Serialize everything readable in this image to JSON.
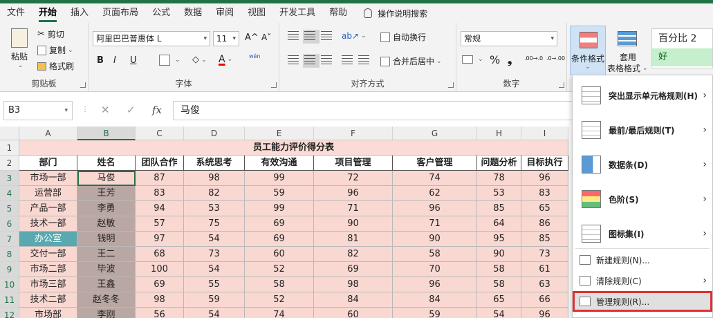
{
  "menu_tabs": [
    "文件",
    "开始",
    "插入",
    "页面布局",
    "公式",
    "数据",
    "审阅",
    "视图",
    "开发工具",
    "帮助"
  ],
  "tell_me": "操作说明搜索",
  "ribbon": {
    "clipboard": {
      "paste": "粘贴",
      "cut": "剪切",
      "copy": "复制",
      "format_painter": "格式刷",
      "label": "剪贴板"
    },
    "font": {
      "family": "阿里巴巴普惠体 L",
      "size": "11",
      "grow": "A^",
      "shrink": "A˅",
      "bold": "B",
      "italic": "I",
      "underline": "U",
      "color_a": "A",
      "phonetic": "wén",
      "label": "字体"
    },
    "alignment": {
      "wrap": "自动换行",
      "merge": "合并后居中",
      "label": "对齐方式"
    },
    "number": {
      "format": "常规",
      "percent": "%",
      "comma": "❟",
      "dec_more": ".00→.0",
      "dec_less": ".0→.00",
      "label": "数字"
    },
    "styles": {
      "conditional": "条件格式",
      "table_format_1": "套用",
      "table_format_2": "表格格式",
      "style_pct": "百分比 2",
      "style_good": "好"
    }
  },
  "formula_bar": {
    "name_box": "B3",
    "cancel": "✕",
    "enter": "✓",
    "fx": "fx",
    "value": "马俊"
  },
  "columns": [
    "A",
    "B",
    "C",
    "D",
    "E",
    "F",
    "G",
    "H",
    "I"
  ],
  "row_numbers": [
    "1",
    "2",
    "3",
    "4",
    "5",
    "6",
    "7",
    "8",
    "9",
    "10",
    "11",
    "12"
  ],
  "table": {
    "title": "员工能力评价得分表",
    "headers": [
      "部门",
      "姓名",
      "团队合作",
      "系统思考",
      "有效沟通",
      "项目管理",
      "客户管理",
      "问题分析",
      "目标执行"
    ],
    "rows": [
      [
        "市场一部",
        "马俊",
        "87",
        "98",
        "99",
        "72",
        "74",
        "78",
        "96"
      ],
      [
        "运营部",
        "王芳",
        "83",
        "82",
        "59",
        "96",
        "62",
        "53",
        "83"
      ],
      [
        "产品一部",
        "李勇",
        "94",
        "53",
        "99",
        "71",
        "96",
        "85",
        "65"
      ],
      [
        "技术一部",
        "赵敏",
        "57",
        "75",
        "69",
        "90",
        "71",
        "64",
        "86"
      ],
      [
        "办公室",
        "钱明",
        "97",
        "54",
        "69",
        "81",
        "90",
        "95",
        "85"
      ],
      [
        "交付一部",
        "王二",
        "68",
        "73",
        "60",
        "82",
        "58",
        "90",
        "73"
      ],
      [
        "市场二部",
        "毕波",
        "100",
        "54",
        "52",
        "69",
        "70",
        "58",
        "61"
      ],
      [
        "市场三部",
        "王鑫",
        "69",
        "55",
        "58",
        "98",
        "96",
        "58",
        "63"
      ],
      [
        "技术二部",
        "赵冬冬",
        "98",
        "59",
        "52",
        "84",
        "84",
        "65",
        "66"
      ],
      [
        "市场部",
        "李刚",
        "56",
        "54",
        "74",
        "60",
        "59",
        "54",
        "96"
      ]
    ]
  },
  "cf_menu": {
    "items": [
      {
        "label": "突出显示单元格规则(H)",
        "has_sub": true
      },
      {
        "label": "最前/最后规则(T)",
        "has_sub": true
      },
      {
        "label": "数据条(D)",
        "has_sub": true
      },
      {
        "label": "色阶(S)",
        "has_sub": true
      },
      {
        "label": "图标集(I)",
        "has_sub": true
      }
    ],
    "new_rule": "新建规则(N)...",
    "clear_rules": "清除规则(C)",
    "manage_rules": "管理规则(R)...",
    "chevron": "›"
  }
}
